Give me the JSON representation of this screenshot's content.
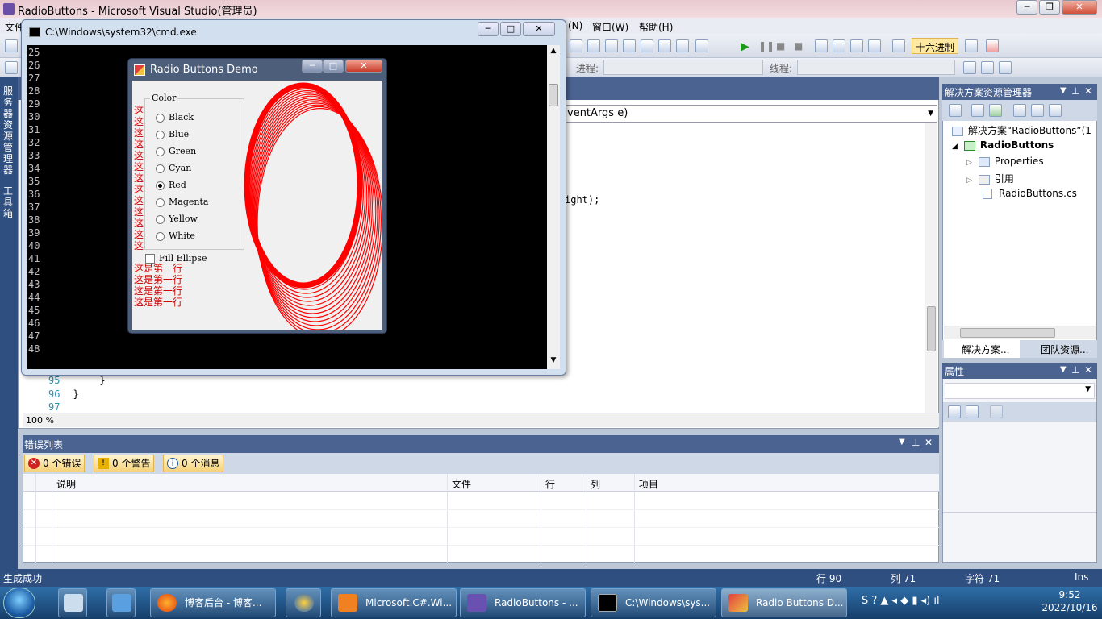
{
  "vs": {
    "title": "RadioButtons - Microsoft Visual Studio(管理员)",
    "menu": [
      "文件",
      "(N)",
      "窗口(W)",
      "帮助(H)"
    ],
    "toolbar_hex": "十六进制",
    "process_label": "进程:",
    "thread_label": "线程:",
    "left_strip": [
      "服务器资源管理器",
      "工具箱"
    ],
    "method_combo": "ventArgs e)",
    "code_fragment": "ight);",
    "code_lines": [
      {
        "num": "95",
        "text": "    }"
      },
      {
        "num": "96",
        "text": "}"
      },
      {
        "num": "97",
        "text": ""
      }
    ],
    "zoom": "100 %"
  },
  "error_list": {
    "title": "错误列表",
    "errors": "0 个错误",
    "warnings": "0 个警告",
    "messages": "0 个消息",
    "columns": [
      "说明",
      "文件",
      "行",
      "列",
      "项目"
    ]
  },
  "solution": {
    "title": "解决方案资源管理器",
    "root": "解决方案“RadioButtons”(1",
    "project": "RadioButtons",
    "items": [
      "Properties",
      "引用",
      "RadioButtons.cs"
    ],
    "tabs": [
      "解决方案...",
      "团队资源..."
    ]
  },
  "properties": {
    "title": "属性"
  },
  "status": {
    "text": "生成成功",
    "row": "行 90",
    "col": "列 71",
    "char": "字符 71",
    "mode": "Ins"
  },
  "cmd": {
    "title": "C:\\Windows\\system32\\cmd.exe",
    "lines": [
      "25",
      "26",
      "27",
      "28",
      "29",
      "30",
      "31",
      "32",
      "33",
      "34",
      "35",
      "36",
      "37",
      "38",
      "39",
      "40",
      "41",
      "42",
      "43",
      "44",
      "45",
      "46",
      "47",
      "48"
    ]
  },
  "radio_demo": {
    "title": "Radio Buttons Demo",
    "group_label": "Color",
    "options": [
      "Black",
      "Blue",
      "Green",
      "Cyan",
      "Red",
      "Magenta",
      "Yellow",
      "White"
    ],
    "selected": "Red",
    "fill_label": "Fill Ellipse",
    "fill_checked": false,
    "red_text_full": "这是第一行",
    "red_text_partial": "这",
    "ellipse_color": "#ff0000"
  },
  "taskbar": {
    "items": [
      "博客后台 - 博客...",
      "Microsoft.C#.Wi...",
      "RadioButtons - ...",
      "C:\\Windows\\sys...",
      "Radio Buttons D..."
    ],
    "time": "9:52",
    "date": "2022/10/16"
  }
}
